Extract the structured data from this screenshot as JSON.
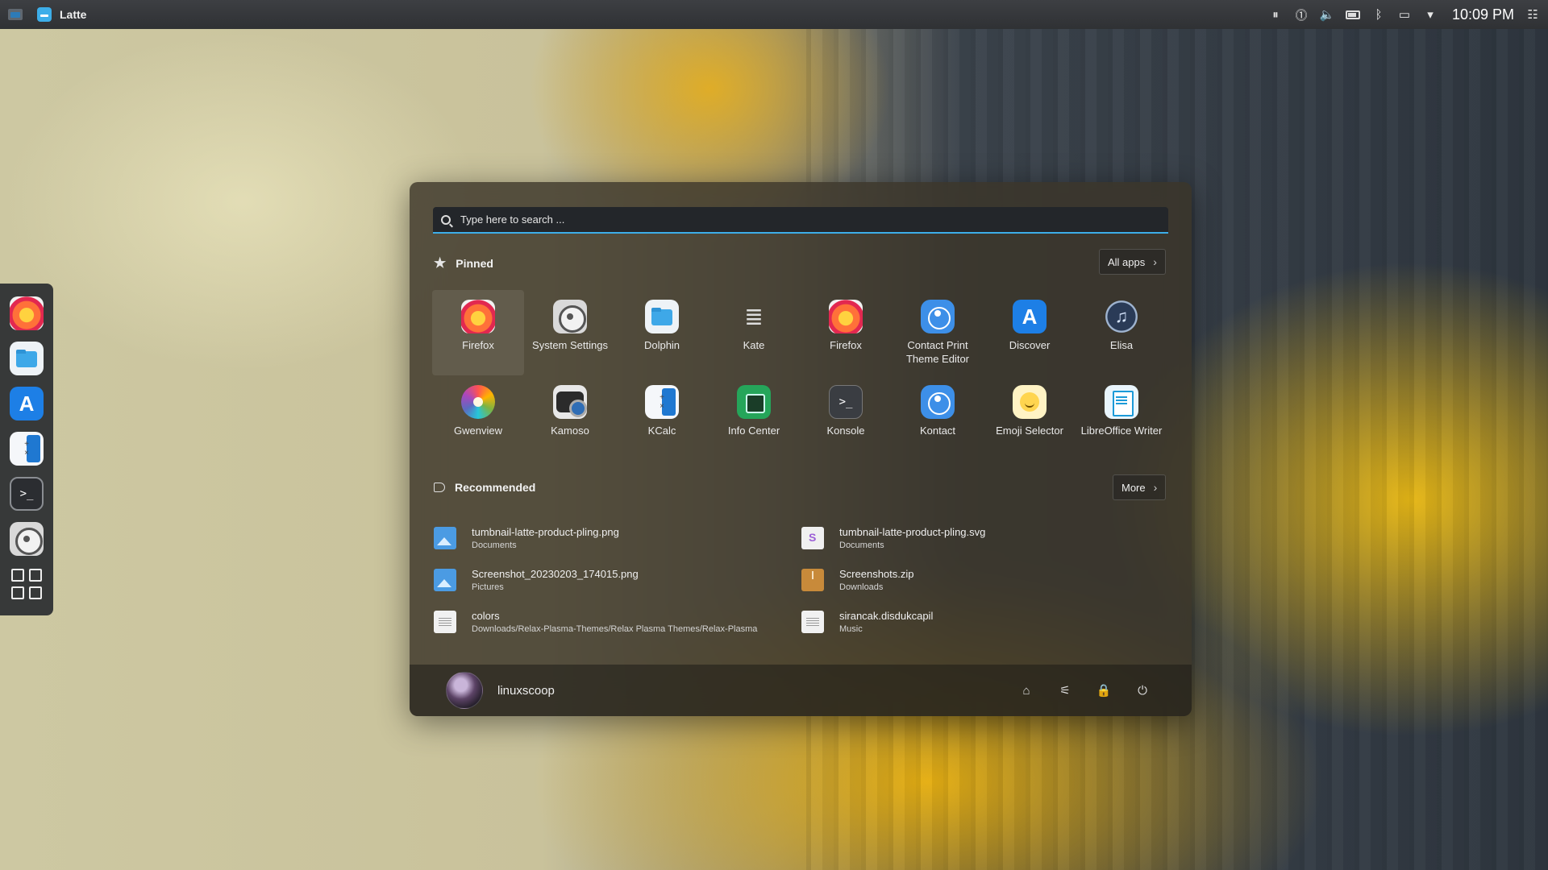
{
  "topbar": {
    "app_name": "Latte",
    "clock": "10:09 PM"
  },
  "dock": {
    "items": [
      "firefox-icon",
      "folder-icon",
      "discover-icon",
      "calculator-icon",
      "terminal-icon",
      "settings-icon",
      "app-grid-icon"
    ]
  },
  "search": {
    "placeholder": "Type here to search ..."
  },
  "pinned": {
    "title": "Pinned",
    "all_apps_label": "All apps",
    "apps": [
      {
        "label": "Firefox",
        "icon": "firefox-icon"
      },
      {
        "label": "System Settings",
        "icon": "settings-icon"
      },
      {
        "label": "Dolphin",
        "icon": "folder-icon"
      },
      {
        "label": "Kate",
        "icon": "kate-icon"
      },
      {
        "label": "Firefox",
        "icon": "firefox-icon"
      },
      {
        "label": "Contact Print Theme Editor",
        "icon": "contact-icon"
      },
      {
        "label": "Discover",
        "icon": "discover-icon"
      },
      {
        "label": "Elisa",
        "icon": "elisa-icon"
      },
      {
        "label": "Gwenview",
        "icon": "gwenview-icon"
      },
      {
        "label": "Kamoso",
        "icon": "kamoso-icon"
      },
      {
        "label": "KCalc",
        "icon": "calculator-icon"
      },
      {
        "label": "Info Center",
        "icon": "info-center-icon"
      },
      {
        "label": "Konsole",
        "icon": "terminal-icon"
      },
      {
        "label": "Kontact",
        "icon": "contact-icon"
      },
      {
        "label": "Emoji Selector",
        "icon": "emoji-icon"
      },
      {
        "label": "LibreOffice Writer",
        "icon": "writer-icon"
      }
    ]
  },
  "recommended": {
    "title": "Recommended",
    "more_label": "More",
    "items": [
      {
        "name": "tumbnail-latte-product-pling.png",
        "path": "Documents",
        "icon": "image-file-icon"
      },
      {
        "name": "tumbnail-latte-product-pling.svg",
        "path": "Documents",
        "icon": "svg-file-icon"
      },
      {
        "name": "Screenshot_20230203_174015.png",
        "path": "Pictures",
        "icon": "image-file-icon"
      },
      {
        "name": "Screenshots.zip",
        "path": "Downloads",
        "icon": "zip-file-icon"
      },
      {
        "name": "colors",
        "path": "Downloads/Relax-Plasma-Themes/Relax Plasma Themes/Relax-Plasma",
        "icon": "text-file-icon"
      },
      {
        "name": "sirancak.disdukcapil",
        "path": "Music",
        "icon": "text-file-icon"
      }
    ]
  },
  "user": {
    "name": "linuxscoop"
  },
  "colors": {
    "accent": "#3daee9"
  }
}
